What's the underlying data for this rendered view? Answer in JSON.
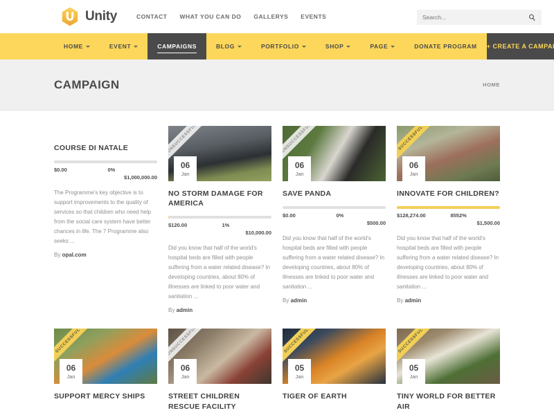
{
  "header": {
    "logo_text": "Unity",
    "logo_icon": "unity-hexagon-logo-icon",
    "top_links": [
      {
        "label": "CONTACT"
      },
      {
        "label": "WHAT YOU CAN DO"
      },
      {
        "label": "GALLERYS"
      },
      {
        "label": "EVENTS"
      }
    ],
    "search": {
      "placeholder": "Search...",
      "value": "",
      "icon": "search-icon"
    }
  },
  "mainnav": {
    "items": [
      {
        "label": "HOME",
        "caret": true,
        "active": false
      },
      {
        "label": "EVENT",
        "caret": true,
        "active": false
      },
      {
        "label": "CAMPAIGNS",
        "caret": false,
        "active": true
      },
      {
        "label": "BLOG",
        "caret": true,
        "active": false
      },
      {
        "label": "PORTFOLIO",
        "caret": true,
        "active": false
      },
      {
        "label": "SHOP",
        "caret": true,
        "active": false
      },
      {
        "label": "PAGE",
        "caret": true,
        "active": false
      },
      {
        "label": "DONATE PROGRAM",
        "caret": false,
        "active": false
      }
    ],
    "cta_label": "+ CREATE A CAMPAIGN"
  },
  "pagehead": {
    "title": "CAMPAIGN",
    "breadcrumb": "HOME"
  },
  "colors": {
    "brand_yellow": "#fcd75b",
    "progress_yellow": "#f2cf56",
    "dark": "#4a4a4a",
    "page_head_bg": "#f0f0f0",
    "bar_empty": "#e0e0e0"
  },
  "campaigns_row1": [
    {
      "has_thumb": false,
      "title": "COURSE DI NATALE",
      "raised": "$0.00",
      "percent_label": "0%",
      "percent_value": 0,
      "goal": "$1,000,000.00",
      "description": "The Programme's key objective is to support improvements to the quality of services so that children who need help from the social care system have better chances in life. The 7 Programme also seeks ...",
      "by_prefix": "By",
      "author": "opal.com"
    },
    {
      "has_thumb": true,
      "ribbon": "UNSUCCESSFUL",
      "ribbon_type": "unsuccessful",
      "day": "06",
      "month": "Jan",
      "image": "storm-supercell-photo",
      "title": "NO STORM DAMAGE FOR AMERICA",
      "raised": "$120.00",
      "percent_label": "1%",
      "percent_value": 1,
      "goal": "$10,000.00",
      "description": "Did you know that half of the world's hospital beds are filled with people suffering from a water related disease? In developing countries, about 80% of illnesses are linked to poor water and sanitation ...",
      "by_prefix": "By",
      "author": "admin"
    },
    {
      "has_thumb": true,
      "ribbon": "UNSUCCESSFUL",
      "ribbon_type": "unsuccessful",
      "day": "06",
      "month": "Jan",
      "image": "panda-eating-bamboo-photo",
      "title": "SAVE PANDA",
      "raised": "$0.00",
      "percent_label": "0%",
      "percent_value": 0,
      "goal": "$500.00",
      "description": "Did you know that half of the world's hospital beds are filled with people suffering from a water related disease? In developing countries, about 80% of illnesses are linked to poor water and sanitation ...",
      "by_prefix": "By",
      "author": "admin"
    },
    {
      "has_thumb": true,
      "ribbon": "SUCCESSFUL",
      "ribbon_type": "successful",
      "day": "06",
      "month": "Jan",
      "image": "group-of-children-outdoors-photo",
      "title": "INNOVATE FOR CHILDREN?",
      "raised": "$128,274.00",
      "percent_label": "8552%",
      "percent_value": 100,
      "goal": "$1,500.00",
      "description": "Did you know that half of the world's hospital beds are filled with people suffering from a water related disease? In developing countries, about 80% of illnesses are linked to poor water and sanitation ...",
      "by_prefix": "By",
      "author": "admin"
    }
  ],
  "campaigns_row2": [
    {
      "has_thumb": true,
      "ribbon": "SUCCESSFUL",
      "ribbon_type": "successful",
      "day": "06",
      "month": "Jan",
      "image": "child-gardening-photo",
      "title": "SUPPORT MERCY SHIPS"
    },
    {
      "has_thumb": true,
      "ribbon": "UNSUCCESSFUL",
      "ribbon_type": "unsuccessful",
      "day": "06",
      "month": "Jan",
      "image": "doctor-with-patient-photo",
      "title": "STREET CHILDREN RESCUE FACILITY"
    },
    {
      "has_thumb": true,
      "ribbon": "SUCCESSFUL",
      "ribbon_type": "successful",
      "day": "05",
      "month": "Jan",
      "image": "tiger-in-water-photo",
      "title": "TIGER OF EARTH"
    },
    {
      "has_thumb": true,
      "ribbon": "SUCCESSFUL",
      "ribbon_type": "successful",
      "day": "05",
      "month": "Jan",
      "image": "miniature-fairy-garden-photo",
      "title": "TINY WORLD FOR BETTER AIR"
    }
  ]
}
